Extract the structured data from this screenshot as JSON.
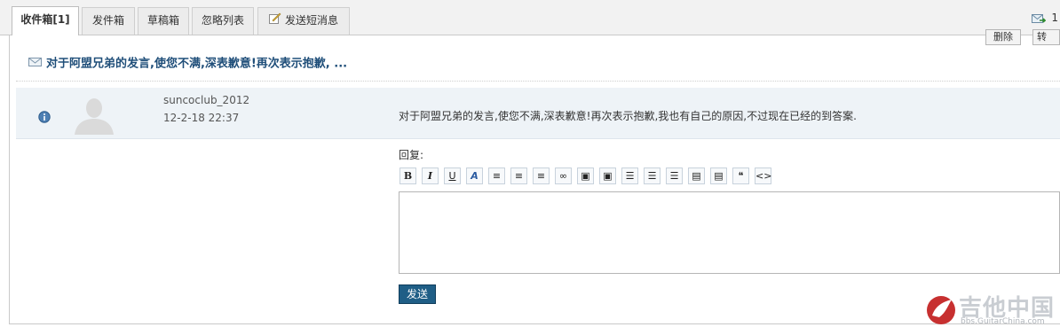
{
  "tabs": [
    {
      "label": "收件箱[1]",
      "active": true
    },
    {
      "label": "发件箱",
      "active": false
    },
    {
      "label": "草稿箱",
      "active": false
    },
    {
      "label": "忽略列表",
      "active": false
    },
    {
      "label": "发送短消息",
      "active": false
    }
  ],
  "header_right": {
    "icon": "mail-forward-icon",
    "count": "1"
  },
  "actions": {
    "delete_label": "删除",
    "forward_label": "转发"
  },
  "message": {
    "subject": "对于阿盟兄弟的发言,使您不满,深表歉意!再次表示抱歉, ...",
    "username": "suncoclub_2012",
    "date": "12-2-18 22:37",
    "body": "对于阿盟兄弟的发言,使您不满,深表歉意!再次表示抱歉,我也有自己的原因,不过现在已经的到答案."
  },
  "reply": {
    "label": "回复:",
    "text": "",
    "send_label": "发送"
  },
  "toolbar": [
    {
      "name": "bold-button",
      "glyph": "B"
    },
    {
      "name": "italic-button",
      "glyph": "I"
    },
    {
      "name": "underline-button",
      "glyph": "U"
    },
    {
      "name": "font-color-button",
      "glyph": "A"
    },
    {
      "name": "align-left-button",
      "glyph": "≡"
    },
    {
      "name": "align-center-button",
      "glyph": "≡"
    },
    {
      "name": "align-right-button",
      "glyph": "≡"
    },
    {
      "name": "link-button",
      "glyph": "∞"
    },
    {
      "name": "image-button",
      "glyph": "▣"
    },
    {
      "name": "insert-image-button",
      "glyph": "▣"
    },
    {
      "name": "ordered-list-button",
      "glyph": "☰"
    },
    {
      "name": "unordered-list-button",
      "glyph": "☰"
    },
    {
      "name": "indent-button",
      "glyph": "☰"
    },
    {
      "name": "float-left-button",
      "glyph": "▤"
    },
    {
      "name": "float-right-button",
      "glyph": "▤"
    },
    {
      "name": "quote-button",
      "glyph": "❝"
    },
    {
      "name": "code-button",
      "glyph": "<>"
    }
  ],
  "watermark": {
    "text": "吉他中国",
    "sub": "bbs.GuitarChina.com"
  },
  "colors": {
    "accent": "#1f5e86",
    "subject": "#1f4e79",
    "row_bg": "#eef3f7"
  }
}
